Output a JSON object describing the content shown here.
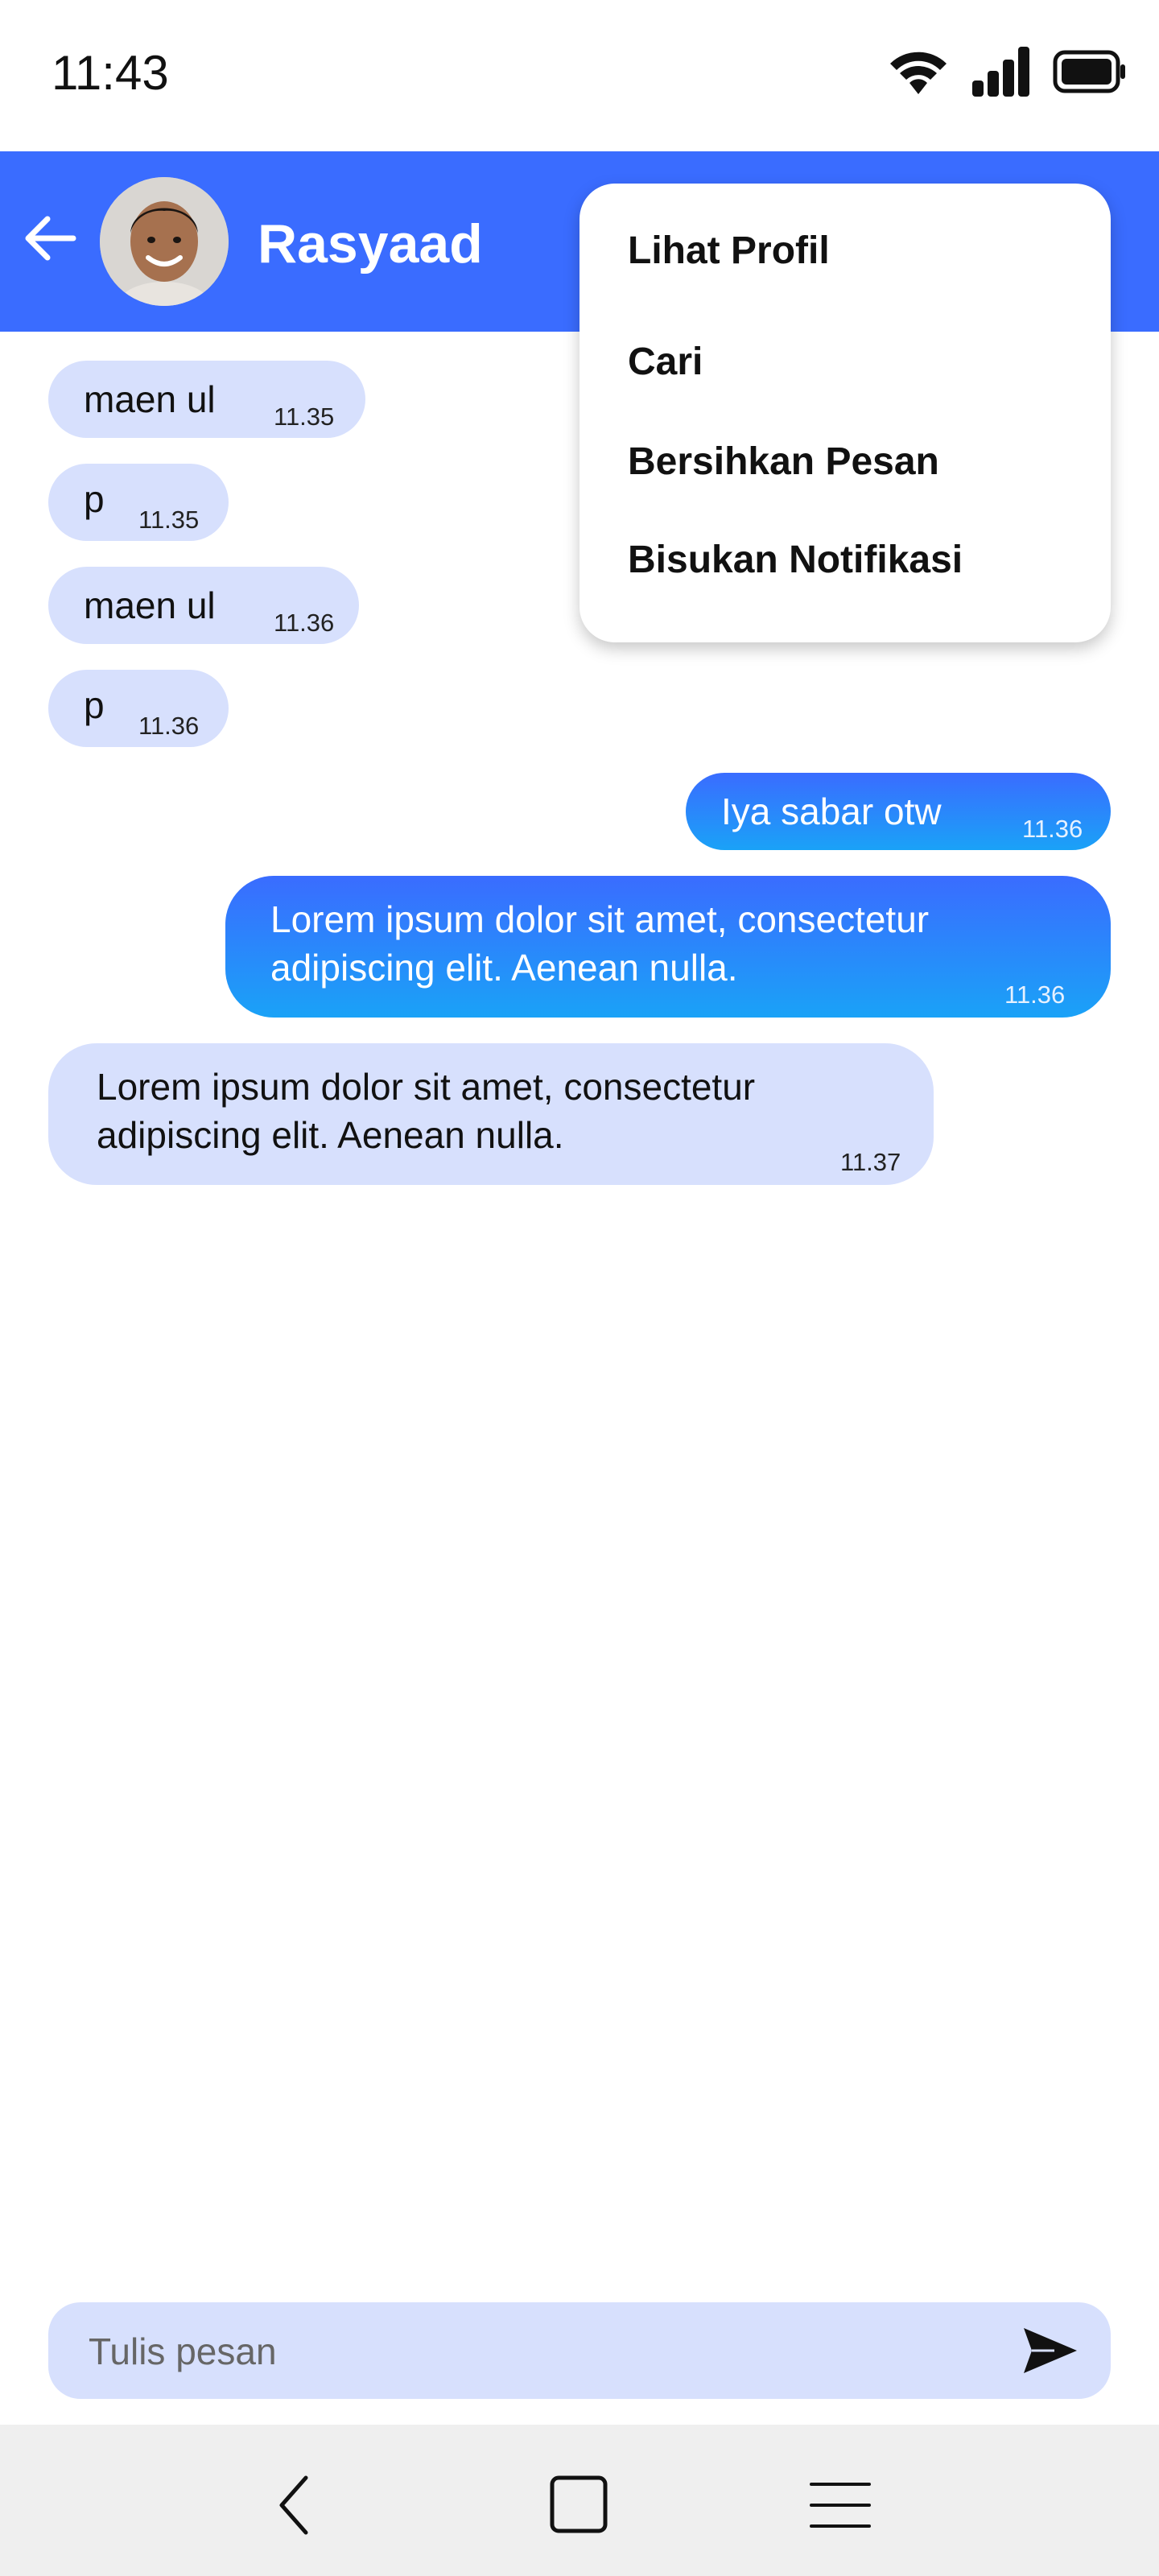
{
  "status_bar": {
    "time": "11:43",
    "icons": [
      "wifi-icon",
      "signal-icon",
      "battery-icon"
    ]
  },
  "header": {
    "contact_name": "Rasyaad",
    "background_color": "#3a6cff",
    "icons": [
      "back-arrow-icon",
      "avatar"
    ]
  },
  "menu": {
    "items": [
      {
        "label": "Lihat Profil"
      },
      {
        "label": "Cari"
      },
      {
        "label": "Bersihkan Pesan"
      },
      {
        "label": "Bisukan Notifikasi"
      }
    ]
  },
  "messages": [
    {
      "direction": "incoming",
      "text": "maen ul",
      "time": "11.35"
    },
    {
      "direction": "incoming",
      "text": "p",
      "time": "11.35"
    },
    {
      "direction": "incoming",
      "text": "maen ul",
      "time": "11.36"
    },
    {
      "direction": "incoming",
      "text": "p",
      "time": "11.36"
    },
    {
      "direction": "outgoing",
      "text": "Iya sabar otw",
      "time": "11.36"
    },
    {
      "direction": "outgoing",
      "text": "Lorem ipsum dolor sit amet, consectetur adipiscing elit. Aenean nulla.",
      "time": "11.36"
    },
    {
      "direction": "incoming",
      "text": "Lorem ipsum dolor sit amet, consectetur adipiscing elit. Aenean nulla.",
      "time": "11.37"
    }
  ],
  "composer": {
    "placeholder": "Tulis pesan",
    "value": "",
    "send_icon": "send-icon"
  },
  "nav_bar": {
    "icons": [
      "back-nav-icon",
      "home-nav-icon",
      "menu-nav-icon"
    ]
  },
  "colors": {
    "incoming_bubble": "#d7e0fd",
    "outgoing_bubble_top": "#3a6cff",
    "outgoing_bubble_bottom": "#1aa2f7",
    "nav_bar": "#efefef"
  }
}
